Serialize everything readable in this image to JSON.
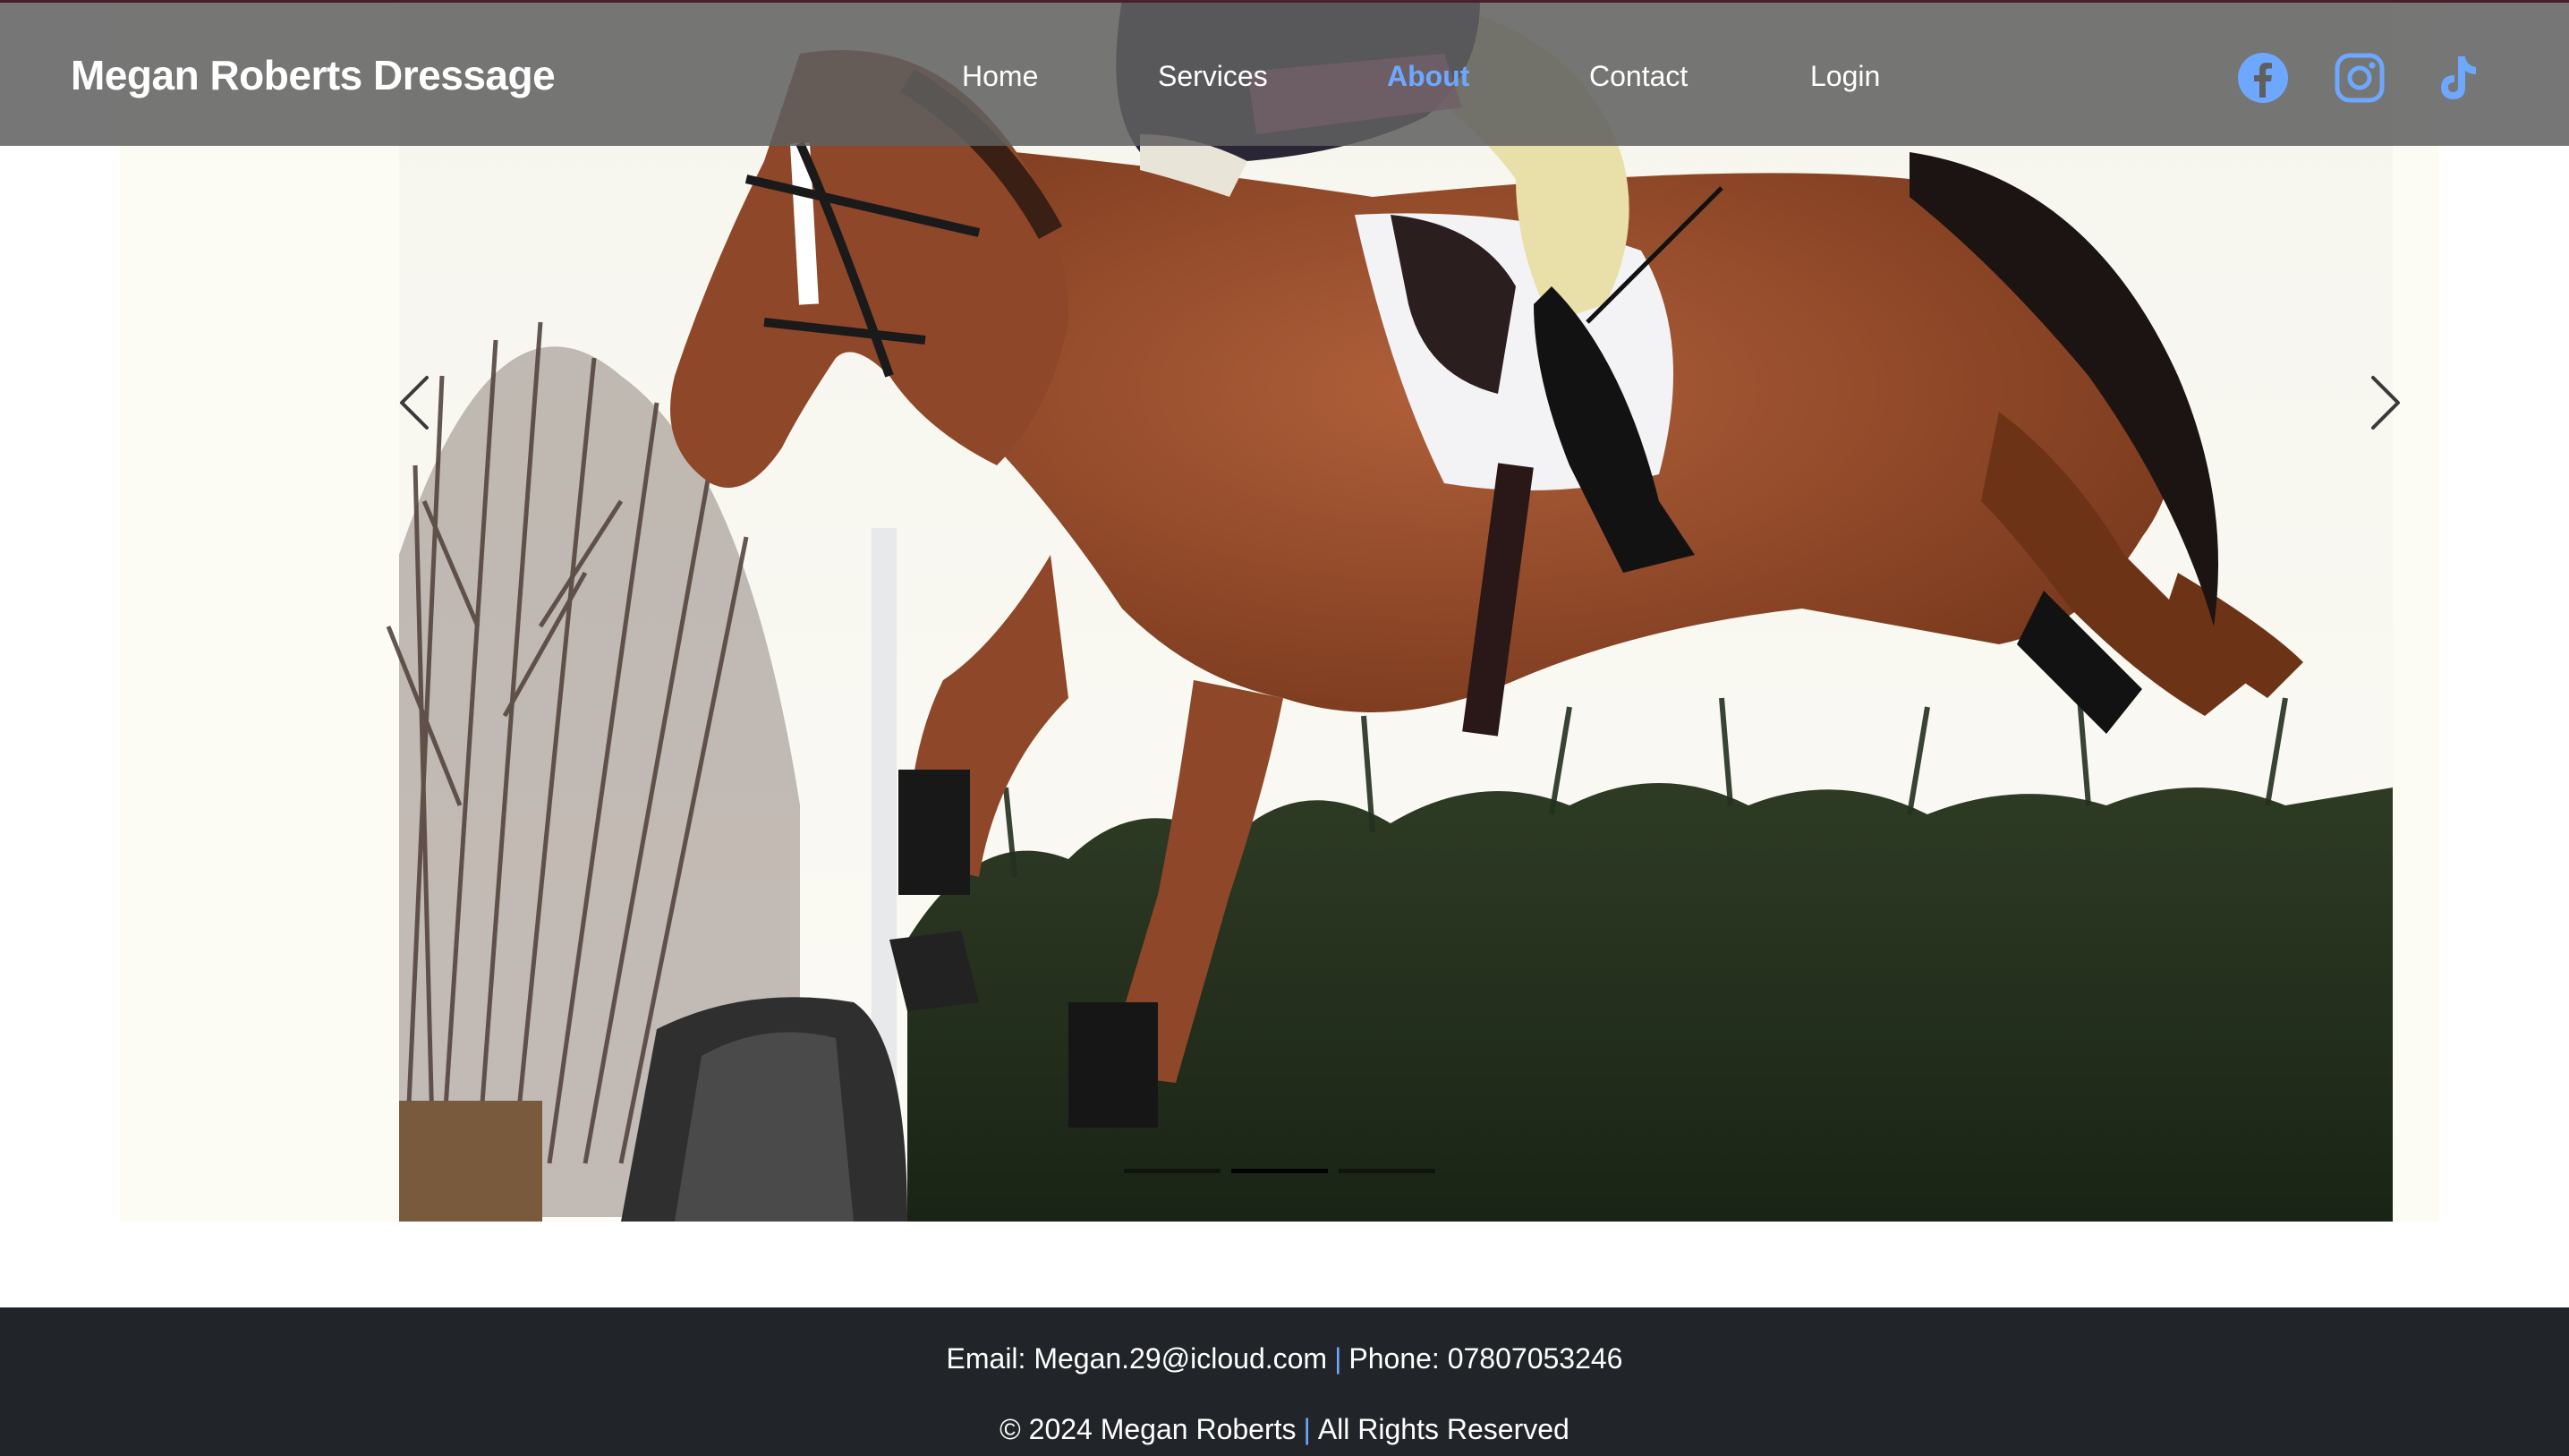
{
  "navbar": {
    "brand": "Megan Roberts Dressage",
    "links": [
      {
        "label": "Home",
        "active": false
      },
      {
        "label": "Services",
        "active": false
      },
      {
        "label": "About",
        "active": true
      },
      {
        "label": "Contact",
        "active": false
      },
      {
        "label": "Login",
        "active": false
      }
    ],
    "social_icons": [
      "facebook-icon",
      "instagram-icon",
      "tiktok-icon"
    ],
    "social_color": "#6ea8fe",
    "active_color": "#6ea8fe"
  },
  "carousel": {
    "prev_icon": "chevron-left-icon",
    "next_icon": "chevron-right-icon",
    "slide_count": 3,
    "active_slide": 2
  },
  "footer": {
    "email_label": "Email:",
    "email": "Megan.29@icloud.com",
    "separator": "|",
    "phone_label": "Phone:",
    "phone": "07807053246",
    "copyright": "© 2024 Megan Roberts",
    "rights": "All Rights Reserved",
    "background": "#212529"
  }
}
